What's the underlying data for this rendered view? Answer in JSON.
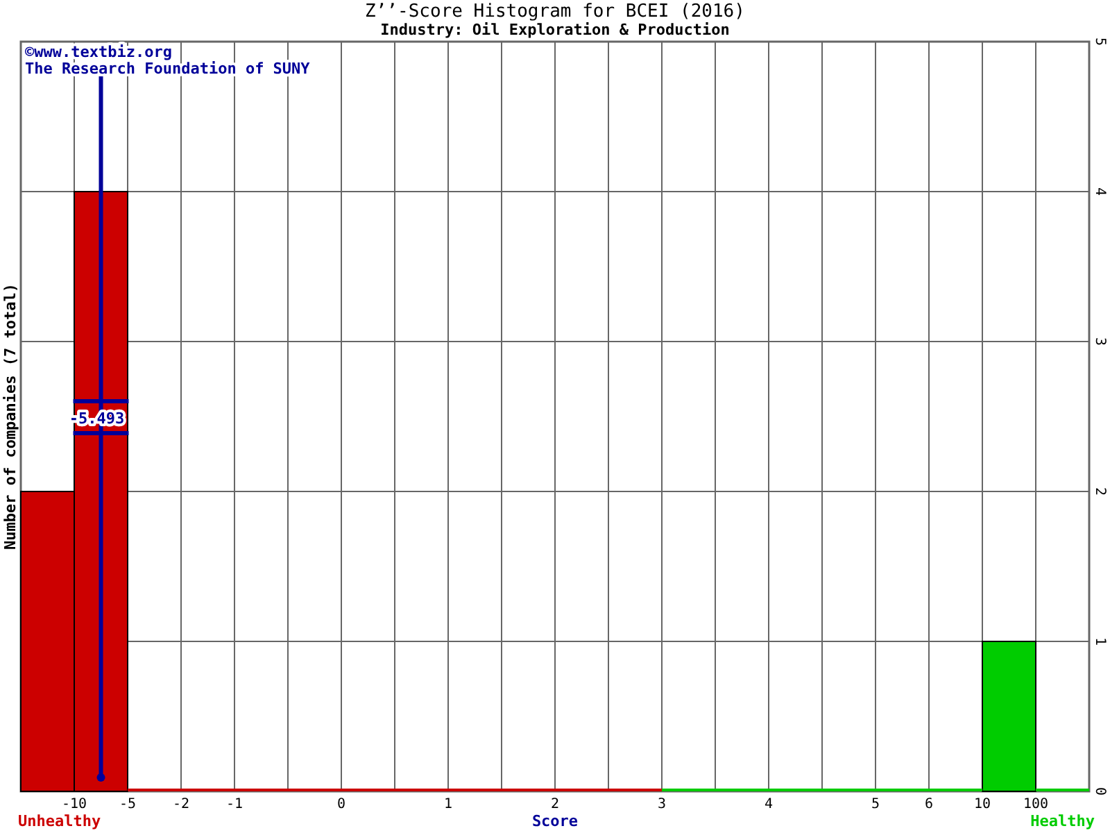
{
  "title": "Z’’-Score Histogram for BCEI (2016)",
  "subtitle": "Industry: Oil Exploration & Production",
  "credits": [
    "©www.textbiz.org",
    "The Research Foundation of SUNY"
  ],
  "chart_data": {
    "type": "bar",
    "xlabel": "Score",
    "ylabel": "Number of companies (7 total)",
    "ylim": [
      0,
      5
    ],
    "yticks": [
      0,
      1,
      2,
      3,
      4,
      5
    ],
    "stacked": true,
    "grid": true,
    "categories": [
      null,
      "-10",
      "-5",
      "-2",
      "-1",
      null,
      "0",
      null,
      "1",
      null,
      "2",
      null,
      "3",
      null,
      "4",
      null,
      "5",
      "6",
      "10",
      "100"
    ],
    "series": [
      {
        "name": "Unhealthy",
        "color": "#cc0000",
        "values": [
          2,
          4,
          0,
          0,
          0,
          0,
          0,
          0,
          0,
          0,
          0,
          0,
          null,
          null,
          null,
          null,
          null,
          null,
          null,
          null
        ]
      },
      {
        "name": "Healthy",
        "color": "#00cc00",
        "values": [
          null,
          null,
          null,
          null,
          null,
          null,
          null,
          null,
          null,
          null,
          null,
          null,
          0,
          0,
          0,
          0,
          0,
          0,
          1,
          0
        ]
      }
    ],
    "annotations": [
      "-5.493"
    ]
  }
}
